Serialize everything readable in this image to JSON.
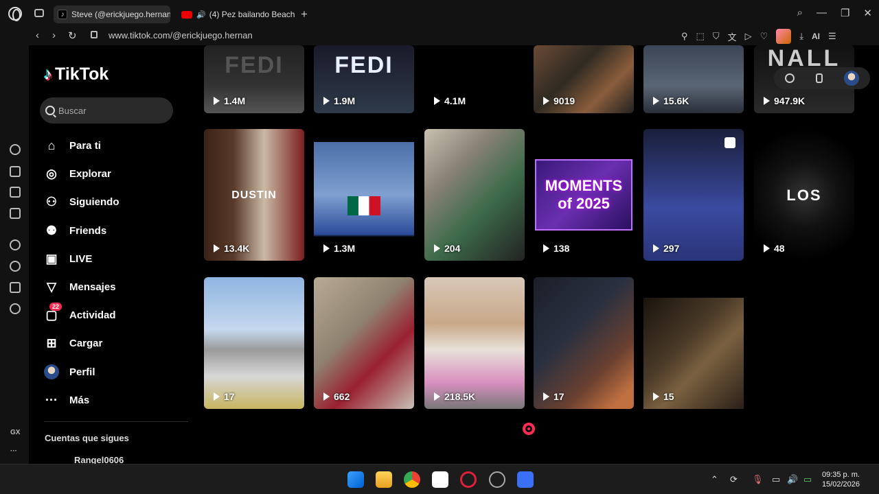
{
  "browser": {
    "tabs": [
      {
        "label": "Steve (@erickjuego.hernan",
        "active": true
      },
      {
        "label": "(4) Pez bailando Beach",
        "active": false
      }
    ],
    "url": "www.tiktok.com/@erickjuego.hernan",
    "ai_label": "AI",
    "gx_label": "GX"
  },
  "tiktok": {
    "logo": "TikTok",
    "search_placeholder": "Buscar",
    "menu": [
      {
        "label": "Para ti",
        "icon": "home-icon"
      },
      {
        "label": "Explorar",
        "icon": "compass-icon"
      },
      {
        "label": "Siguiendo",
        "icon": "following-icon"
      },
      {
        "label": "Friends",
        "icon": "friends-icon"
      },
      {
        "label": "LIVE",
        "icon": "live-icon"
      },
      {
        "label": "Mensajes",
        "icon": "messages-icon"
      },
      {
        "label": "Actividad",
        "icon": "activity-icon",
        "badge": "22"
      },
      {
        "label": "Cargar",
        "icon": "upload-icon"
      },
      {
        "label": "Perfil",
        "icon": "profile-avatar"
      },
      {
        "label": "Más",
        "icon": "more-icon"
      }
    ],
    "following_header": "Cuentas que sigues",
    "following_user": "Rangel0606",
    "videos": [
      {
        "views": "1.4M",
        "text": "FEDI"
      },
      {
        "views": "1.9M",
        "text": "FEDI"
      },
      {
        "views": "4.1M",
        "text": ""
      },
      {
        "views": "9019",
        "text": ""
      },
      {
        "views": "15.6K",
        "text": ""
      },
      {
        "views": "947.9K",
        "text": "NALL"
      },
      {
        "views": "13.4K",
        "text": "DUSTIN"
      },
      {
        "views": "1.3M",
        "text": "Mx"
      },
      {
        "views": "204",
        "text": ""
      },
      {
        "views": "138",
        "text": "MOMENTS of 2025"
      },
      {
        "views": "297",
        "text": ""
      },
      {
        "views": "48",
        "text": "LOS"
      },
      {
        "views": "17",
        "text": ""
      },
      {
        "views": "662",
        "text": ""
      },
      {
        "views": "218.5K",
        "text": ""
      },
      {
        "views": "17",
        "text": ""
      },
      {
        "views": "15",
        "text": ""
      }
    ]
  },
  "taskbar": {
    "time": "09:35 p. m.",
    "date": "15/02/2026"
  }
}
